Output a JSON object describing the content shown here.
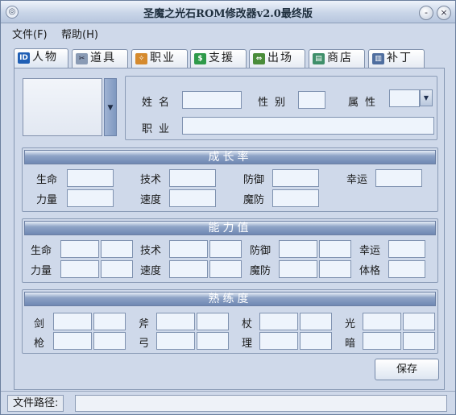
{
  "window": {
    "title": "圣魔之光石ROM修改器v2.0最终版"
  },
  "titlebar": {
    "icon": "app-icon",
    "minimize": "-",
    "close": "×"
  },
  "menu": [
    {
      "label": "文件(F)"
    },
    {
      "label": "帮助(H)"
    }
  ],
  "tabs": [
    {
      "label": "人物",
      "icon": "id-card-icon",
      "active": true
    },
    {
      "label": "道具",
      "icon": "scissors-icon"
    },
    {
      "label": "职业",
      "icon": "class-icon"
    },
    {
      "label": "支援",
      "icon": "support-icon"
    },
    {
      "label": "出场",
      "icon": "arrows-icon"
    },
    {
      "label": "商店",
      "icon": "shop-icon"
    },
    {
      "label": "补丁",
      "icon": "patch-icon"
    }
  ],
  "character": {
    "name_label": "姓名",
    "gender_label": "性别",
    "attribute_label": "属性",
    "class_label": "职业",
    "name_value": "",
    "gender_value": "",
    "attribute_value": "",
    "class_value": ""
  },
  "growth": {
    "title": "成长率",
    "row1": [
      "生命",
      "技术",
      "防御",
      "幸运"
    ],
    "row2": [
      "力量",
      "速度",
      "魔防"
    ]
  },
  "ability": {
    "title": "能力值",
    "row1": [
      "生命",
      "技术",
      "防御",
      "幸运"
    ],
    "row2": [
      "力量",
      "速度",
      "魔防",
      "体格"
    ]
  },
  "proficiency": {
    "title": "熟练度",
    "row1": [
      "剑",
      "斧",
      "杖",
      "光"
    ],
    "row2": [
      "枪",
      "弓",
      "理",
      "暗"
    ]
  },
  "buttons": {
    "save": "保存"
  },
  "status": {
    "path_label": "文件路径:",
    "path_value": ""
  }
}
